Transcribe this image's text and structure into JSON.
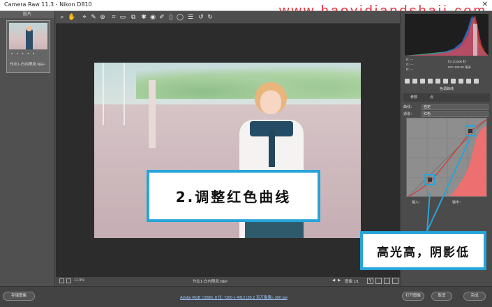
{
  "titlebar": {
    "title": "Camera Raw 11.3 -  Nikon D810",
    "close_glyph": "✕"
  },
  "watermark": "www.haoyidiandshaji.com",
  "filmstrip": {
    "header": "胶片",
    "stars": "• • • • •",
    "filename": "作业1-白内障夙.NEF",
    "button_label": "存储图像"
  },
  "toolbar": {
    "tools": [
      {
        "name": "zoom-tool",
        "glyph": "⌕"
      },
      {
        "name": "hand-tool",
        "glyph": "✋"
      },
      {
        "name": "white-balance-tool",
        "glyph": "⌖"
      },
      {
        "name": "color-sampler-tool",
        "glyph": "✎"
      },
      {
        "name": "targeted-adjust-tool",
        "glyph": "⊕"
      },
      {
        "name": "crop-tool",
        "glyph": "⌗"
      },
      {
        "name": "straighten-tool",
        "glyph": "▭"
      },
      {
        "name": "transform-tool",
        "glyph": "⧉"
      },
      {
        "name": "spot-removal-tool",
        "glyph": "✱"
      },
      {
        "name": "red-eye-tool",
        "glyph": "◉"
      },
      {
        "name": "adjustment-brush-tool",
        "glyph": "✐"
      },
      {
        "name": "graduated-filter-tool",
        "glyph": "▯"
      },
      {
        "name": "radial-filter-tool",
        "glyph": "◯"
      },
      {
        "name": "preferences-tool",
        "glyph": "☰"
      },
      {
        "name": "rotate-left-tool",
        "glyph": "↺"
      },
      {
        "name": "rotate-right-tool",
        "glyph": "↻"
      }
    ]
  },
  "callout_main": "2.调整红色曲线",
  "canvas_status": {
    "zoom": "11.9%",
    "filename": "作业1-白内障夙.NEF",
    "page_label": "图像 1/1"
  },
  "bottombar": {
    "info": "Adobe RGB (1998); 8 位; 7360 x 4912 (36.2 百万像素); 300 ppi",
    "open_label": "打开图像",
    "done_label": "完成",
    "cancel_label": "取消"
  },
  "rpanel": {
    "readout_left": [
      "R:   ---",
      "G:   ---",
      "B:   ---"
    ],
    "readout_right": [
      "f/3    1/1000 秒",
      "ISO 100   85 毫米"
    ],
    "panel_title": "色调曲线",
    "subtab_param": "参数",
    "subtab_point": "点",
    "curve_label": "曲线：",
    "curve_value": "自定",
    "channel_label": "通道：",
    "channel_value": "红色",
    "input_label": "输入：",
    "output_label": "输出："
  },
  "callout_side": "高光高，阴影低",
  "colors": {
    "accent_blue": "#27a4d8",
    "watermark_red": "#e0202a",
    "curve_red": "#ff5a5a"
  }
}
